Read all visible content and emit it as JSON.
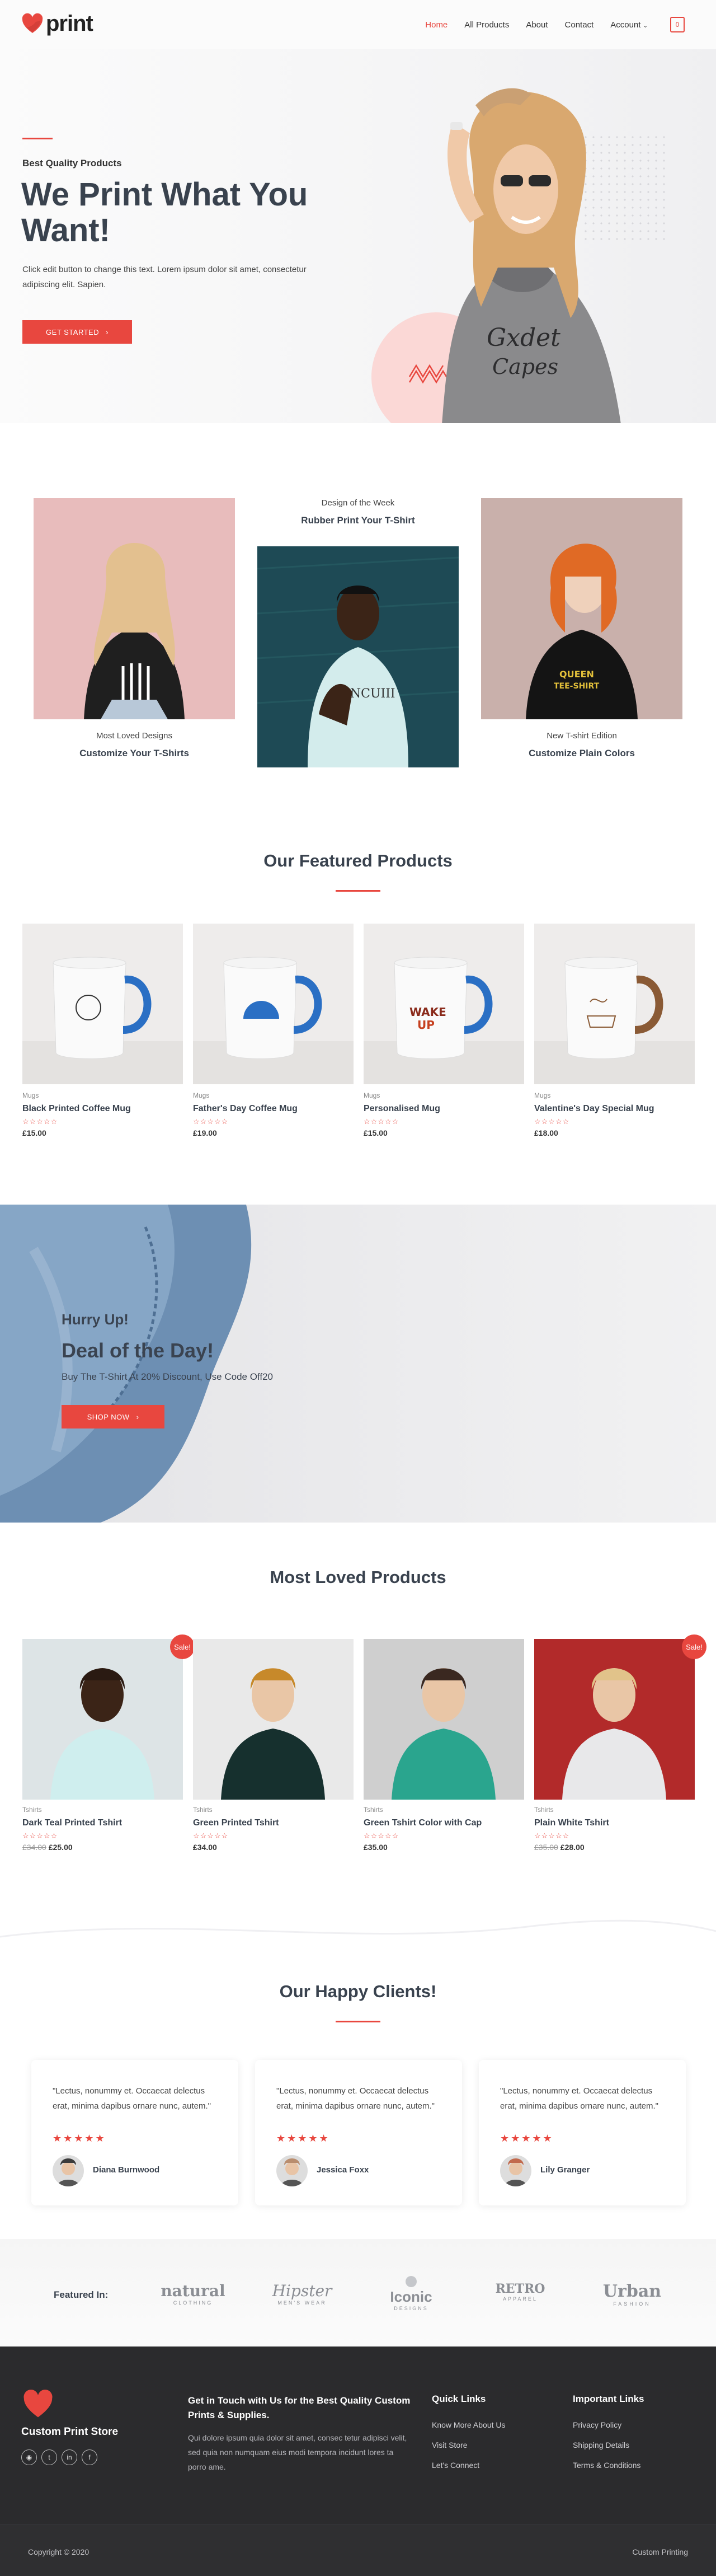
{
  "header": {
    "logo_text": "print",
    "nav": [
      "Home",
      "All Products",
      "About",
      "Contact",
      "Account"
    ],
    "cart_count": "0",
    "brand_color": "#e8473f"
  },
  "hero": {
    "eyebrow": "Best Quality Products",
    "title": "We Print What You Want!",
    "text": "Click edit button to change this text. Lorem ipsum dolor sit amet, consectetur adipiscing elit. Sapien.",
    "button": "GET STARTED"
  },
  "designs": {
    "left": {
      "small": "Most Loved Designs",
      "big": "Customize Your T-Shirts"
    },
    "center": {
      "small": "Design of the Week",
      "big": "Rubber Print Your T-Shirt"
    },
    "right": {
      "small": "New T-shirt Edition",
      "big": "Customize Plain Colors"
    }
  },
  "featured": {
    "title": "Our Featured Products",
    "products": [
      {
        "category": "Mugs",
        "name": "Black Printed Coffee Mug",
        "price": "£15.00",
        "rating": 0
      },
      {
        "category": "Mugs",
        "name": "Father's Day Coffee Mug",
        "price": "£19.00",
        "rating": 0
      },
      {
        "category": "Mugs",
        "name": "Personalised Mug",
        "price": "£15.00",
        "rating": 0
      },
      {
        "category": "Mugs",
        "name": "Valentine's Day Special Mug",
        "price": "£18.00",
        "rating": 0
      }
    ]
  },
  "deal": {
    "hurry": "Hurry Up!",
    "title": "Deal of the Day!",
    "text": "Buy The T-Shirt At 20% Discount, Use Code Off20",
    "button": "SHOP NOW"
  },
  "loved": {
    "title": "Most Loved Products",
    "sale_label": "Sale!",
    "products": [
      {
        "category": "Tshirts",
        "name": "Dark Teal Printed Tshirt",
        "old_price": "£34.00",
        "price": "£25.00",
        "sale": true
      },
      {
        "category": "Tshirts",
        "name": "Green Printed Tshirt",
        "old_price": "",
        "price": "£34.00",
        "sale": false
      },
      {
        "category": "Tshirts",
        "name": "Green Tshirt Color with Cap",
        "old_price": "",
        "price": "£35.00",
        "sale": false
      },
      {
        "category": "Tshirts",
        "name": "Plain White Tshirt",
        "old_price": "£35.00",
        "price": "£28.00",
        "sale": true
      }
    ]
  },
  "clients": {
    "title": "Our Happy Clients!",
    "items": [
      {
        "quote": "\"Lectus, nonummy et. Occaecat delectus erat, minima dapibus ornare nunc, autem.\"",
        "stars": 5,
        "name": "Diana Burnwood"
      },
      {
        "quote": "\"Lectus, nonummy et. Occaecat delectus erat, minima dapibus ornare nunc, autem.\"",
        "stars": 5,
        "name": "Jessica Foxx"
      },
      {
        "quote": "\"Lectus, nonummy et. Occaecat delectus erat, minima dapibus ornare nunc, autem.\"",
        "stars": 5,
        "name": "Lily Granger"
      }
    ]
  },
  "featured_in": {
    "label": "Featured In:",
    "brands": [
      {
        "main": "natural",
        "sub": "CLOTHING"
      },
      {
        "main": "Hipster",
        "sub": "MEN'S WEAR"
      },
      {
        "main": "Iconic",
        "sub": "DESIGNS"
      },
      {
        "main": "RETRO",
        "sub": "APPAREL"
      },
      {
        "main": "Urban",
        "sub": "FASHION"
      }
    ]
  },
  "footer": {
    "store": "Custom Print Store",
    "social": [
      "instagram-icon",
      "twitter-icon",
      "linkedin-icon",
      "facebook-icon"
    ],
    "contact_title": "Get in Touch with Us for the Best Quality Custom Prints & Supplies.",
    "contact_text": "Qui dolore ipsum quia dolor sit amet, consec tetur adipisci velit, sed quia non numquam eius modi tempora incidunt lores ta porro ame.",
    "quick_title": "Quick Links",
    "quick_links": [
      "Know More About Us",
      "Visit Store",
      "Let's Connect"
    ],
    "important_title": "Important Links",
    "important_links": [
      "Privacy Policy",
      "Shipping Details",
      "Terms & Conditions"
    ],
    "copyright": "Copyright © 2020",
    "credit": "Custom Printing"
  }
}
